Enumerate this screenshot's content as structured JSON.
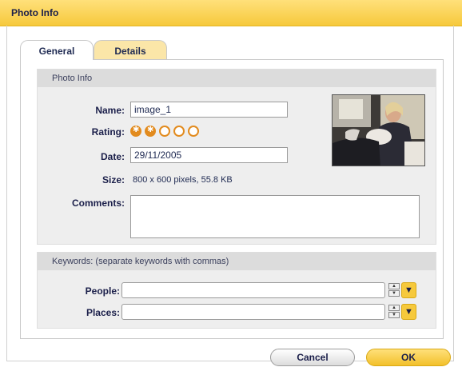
{
  "window": {
    "title": "Photo Info"
  },
  "tabs": [
    {
      "label": "General",
      "active": true
    },
    {
      "label": "Details",
      "active": false
    }
  ],
  "photo_info": {
    "heading": "Photo Info",
    "name_label": "Name:",
    "name_value": "image_1",
    "rating_label": "Rating:",
    "rating": {
      "value": 2,
      "max": 5
    },
    "date_label": "Date:",
    "date_value": "29/11/2005",
    "size_label": "Size:",
    "size_value": "800 x 600 pixels, 55.8 KB",
    "comments_label": "Comments:",
    "comments_value": ""
  },
  "keywords": {
    "heading": "Keywords: (separate keywords with commas)",
    "people_label": "People:",
    "people_value": "",
    "places_label": "Places:",
    "places_value": ""
  },
  "buttons": {
    "cancel": "Cancel",
    "ok": "OK"
  },
  "colors": {
    "accent": "#f6c93c",
    "star": "#e28b1e",
    "text": "#1b1f4a"
  }
}
